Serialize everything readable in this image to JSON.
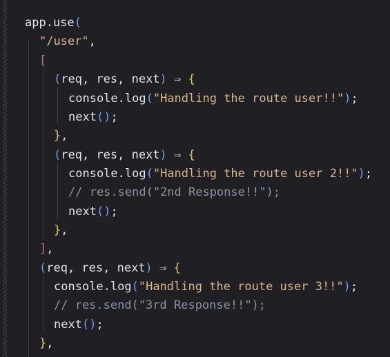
{
  "editor": {
    "lines": [
      {
        "id": "l1",
        "text": "app.use("
      },
      {
        "id": "l2",
        "text": "\"/user\","
      },
      {
        "id": "l3",
        "text": "["
      },
      {
        "id": "l4",
        "text": "(req, res, next) ⇒ {"
      },
      {
        "id": "l5",
        "text": "console.log(\"Handling the route user!!\");"
      },
      {
        "id": "l6",
        "text": "next();"
      },
      {
        "id": "l7",
        "text": "},"
      },
      {
        "id": "l8",
        "text": "(req, res, next) ⇒ {"
      },
      {
        "id": "l9",
        "text": "console.log(\"Handling the route user 2!!\");"
      },
      {
        "id": "l10",
        "text": "// res.send(\"2nd Response!!\");"
      },
      {
        "id": "l11",
        "text": "next();"
      },
      {
        "id": "l12",
        "text": "},"
      },
      {
        "id": "l13",
        "text": "],"
      },
      {
        "id": "l14",
        "text": "(req, res, next) ⇒ {"
      },
      {
        "id": "l15",
        "text": "console.log(\"Handling the route user 3!!\");"
      },
      {
        "id": "l16",
        "text": "// res.send(\"3rd Response!!\");"
      },
      {
        "id": "l17",
        "text": "next();"
      },
      {
        "id": "l18",
        "text": "},"
      }
    ]
  },
  "colors": {
    "background": "#1f1f24",
    "text": "#e2e4ea",
    "string": "#d9b88c",
    "comment": "#8d93a6",
    "bracket": "#d45e9e",
    "brace": "#e7c85a"
  }
}
